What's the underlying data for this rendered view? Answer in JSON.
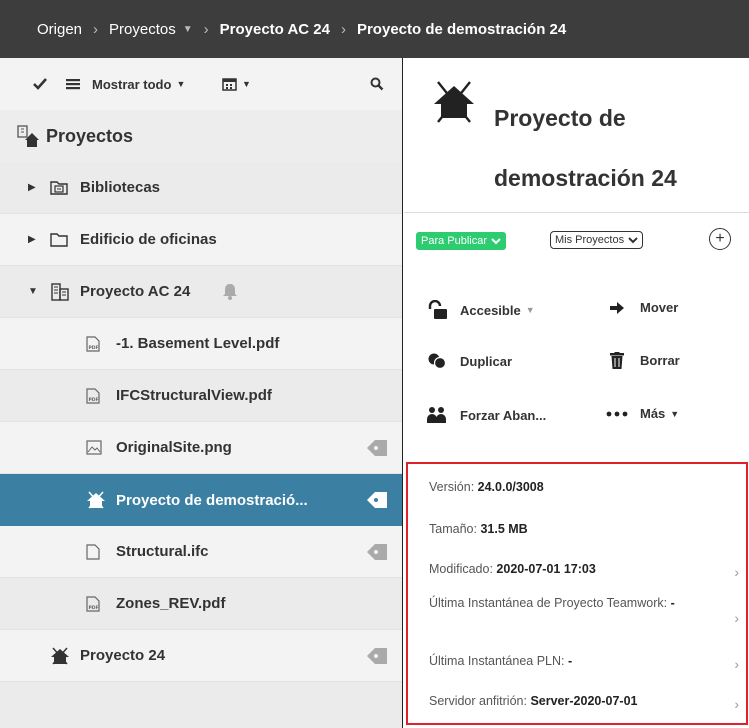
{
  "breadcrumb": {
    "items": [
      "Origen",
      "Proyectos",
      "Proyecto AC 24",
      "Proyecto de demostración 24"
    ],
    "separator": ">"
  },
  "toolbar": {
    "show_all_label": "Mostrar todo",
    "icons": [
      "check-icon",
      "list-icon",
      "calendar-icon",
      "search-icon"
    ]
  },
  "tree": {
    "title": "Proyectos",
    "items": [
      {
        "label": "Bibliotecas",
        "icon": "library-folder-icon",
        "expandable": true
      },
      {
        "label": "Edificio de oficinas",
        "icon": "folder-icon",
        "expandable": true
      },
      {
        "label": "Proyecto AC 24",
        "icon": "building-icon",
        "expanded": true
      },
      {
        "label": "-1. Basement Level.pdf",
        "icon": "pdf-file-icon"
      },
      {
        "label": "IFCStructuralView.pdf",
        "icon": "pdf-file-icon"
      },
      {
        "label": "OriginalSite.png",
        "icon": "image-file-icon",
        "tag": true
      },
      {
        "label": "Proyecto de demostració...",
        "icon": "project-icon",
        "tag": true,
        "selected": true
      },
      {
        "label": "Structural.ifc",
        "icon": "file-icon",
        "tag": true
      },
      {
        "label": "Zones_REV.pdf",
        "icon": "pdf-file-icon"
      },
      {
        "label": "Proyecto 24",
        "icon": "project-icon",
        "tag": true
      }
    ]
  },
  "detail": {
    "title": "Proyecto de demostración 24",
    "status_badge": "Para Publicar",
    "filter_select": "Mis Proyectos",
    "actions": {
      "accessible": "Accesible",
      "move": "Mover",
      "duplicate": "Duplicar",
      "delete": "Borrar",
      "force_leave": "Forzar Aban...",
      "more": "Más"
    },
    "info": [
      {
        "label": "Versión:",
        "value": "24.0.0/3008",
        "chevron": false
      },
      {
        "label": "Tamaño:",
        "value": "31.5 MB",
        "chevron": false
      },
      {
        "label": "Modificado:",
        "value": "2020-07-01 17:03",
        "chevron": true
      },
      {
        "label": "Última Instantánea de Proyecto Teamwork:",
        "value": "-",
        "chevron": true
      },
      {
        "label": "Última Instantánea PLN:",
        "value": "-",
        "chevron": true
      },
      {
        "label": "Servidor anfitrión:",
        "value": "Server-2020-07-01",
        "chevron": true
      }
    ]
  },
  "colors": {
    "topbar": "#3d3d3d",
    "selected_row": "#3b7fa3",
    "badge_green": "#2ecc71",
    "highlight_border": "#e0202a"
  }
}
